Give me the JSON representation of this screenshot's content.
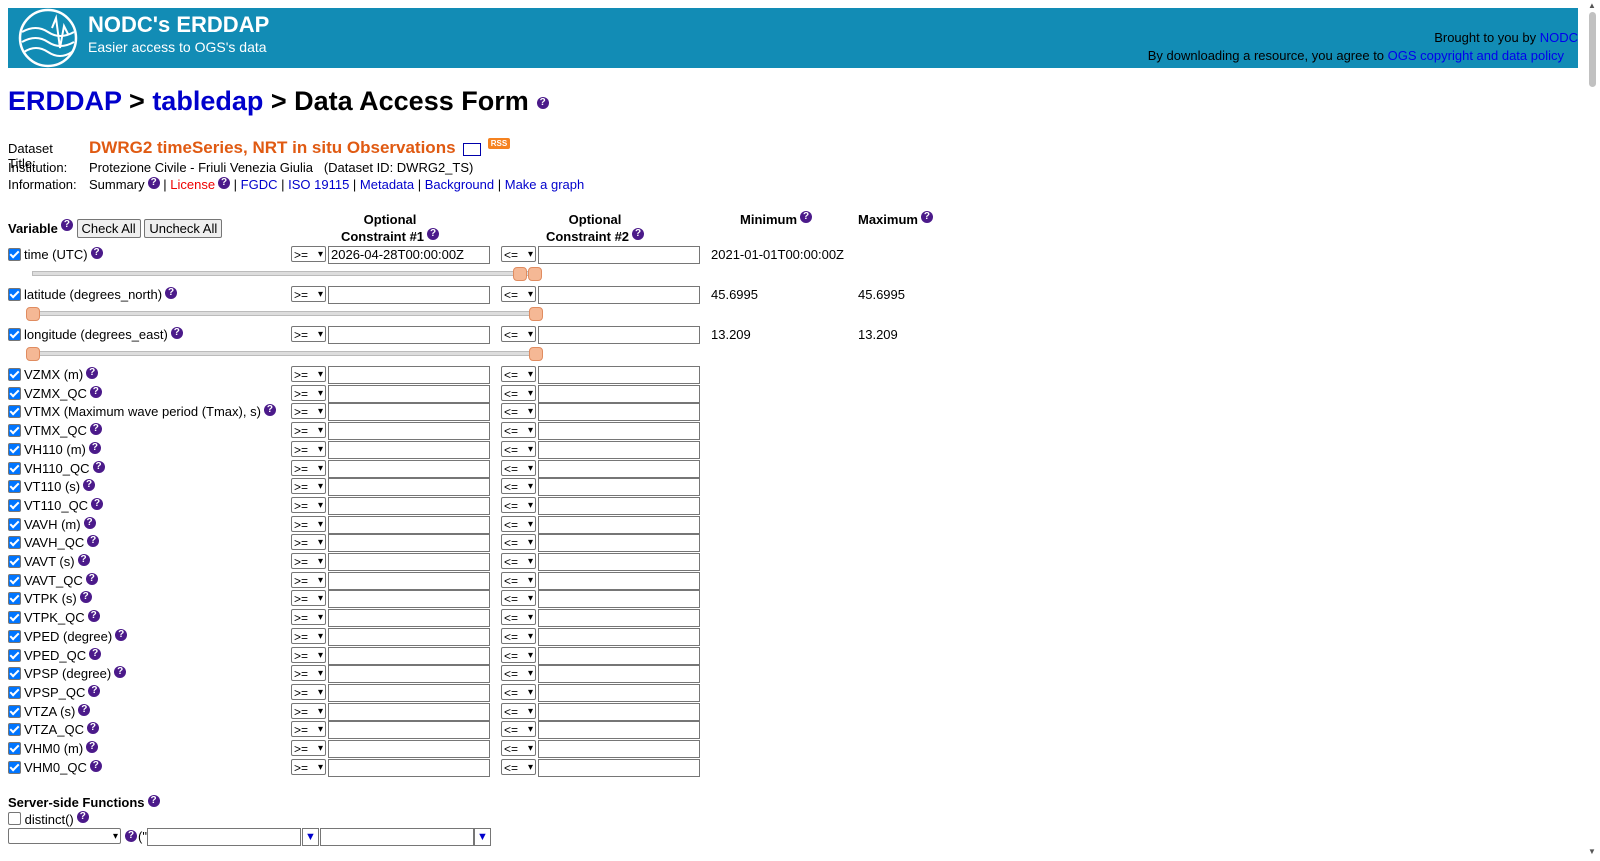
{
  "header": {
    "title": "NODC's ERDDAP",
    "subtitle": "Easier access to OGS's data",
    "brought_by": "Brought to you by",
    "brought_link": "NODC",
    "agree_text": "By downloading a resource, you agree to",
    "agree_link": "OGS copyright and data policy",
    "color": "#128cb5"
  },
  "breadcrumb": {
    "erddap": "ERDDAP",
    "sep1": " > ",
    "tabledap": "tabledap",
    "sep2": " > ",
    "page": "Data Access Form"
  },
  "dataset": {
    "title_label": "Dataset Title:",
    "title": "DWRG2 timeSeries, NRT in situ Observations",
    "rss": "RSS",
    "institution_label": "Institution:",
    "institution": "Protezione Civile - Friuli Venezia Giulia",
    "dataset_id": "(Dataset ID: DWRG2_TS)",
    "information_label": "Information:",
    "links": {
      "summary": "Summary",
      "license": "License",
      "fgdc": "FGDC",
      "iso": "ISO 19115",
      "metadata": "Metadata",
      "background": "Background",
      "graph": "Make a graph"
    },
    "sep": " | "
  },
  "table": {
    "variable_label": "Variable",
    "check_all": "Check All",
    "uncheck_all": "Uncheck All",
    "opt1_line1": "Optional",
    "opt1_line2": "Constraint #1",
    "opt2_line1": "Optional",
    "opt2_line2": "Constraint #2",
    "minimum": "Minimum",
    "maximum": "Maximum",
    "op1": ">=",
    "op2": "<=",
    "time": {
      "name": "time (UTC)",
      "value1": "2026-04-28T00:00:00Z",
      "min": "2021-01-01T00:00:00Z",
      "max": ""
    },
    "latitude": {
      "name": "latitude (degrees_north)",
      "min": "45.6995",
      "max": "45.6995"
    },
    "longitude": {
      "name": "longitude (degrees_east)",
      "min": "13.209",
      "max": "13.209"
    },
    "vars": [
      "VZMX (m)",
      "VZMX_QC",
      "VTMX (Maximum wave period (Tmax), s)",
      "VTMX_QC",
      "VH110 (m)",
      "VH110_QC",
      "VT110 (s)",
      "VT110_QC",
      "VAVH (m)",
      "VAVH_QC",
      "VAVT (s)",
      "VAVT_QC",
      "VTPK (s)",
      "VTPK_QC",
      "VPED (degree)",
      "VPED_QC",
      "VPSP (degree)",
      "VPSP_QC",
      "VTZA (s)",
      "VTZA_QC",
      "VHM0 (m)",
      "VHM0_QC"
    ]
  },
  "server_functions": {
    "label": "Server-side Functions",
    "distinct": "distinct()",
    "paren": "(\""
  },
  "icons": [
    "logo-globe-icon",
    "help-icon",
    "mail-icon",
    "rss-icon",
    "dropdown-arrow-icon"
  ]
}
